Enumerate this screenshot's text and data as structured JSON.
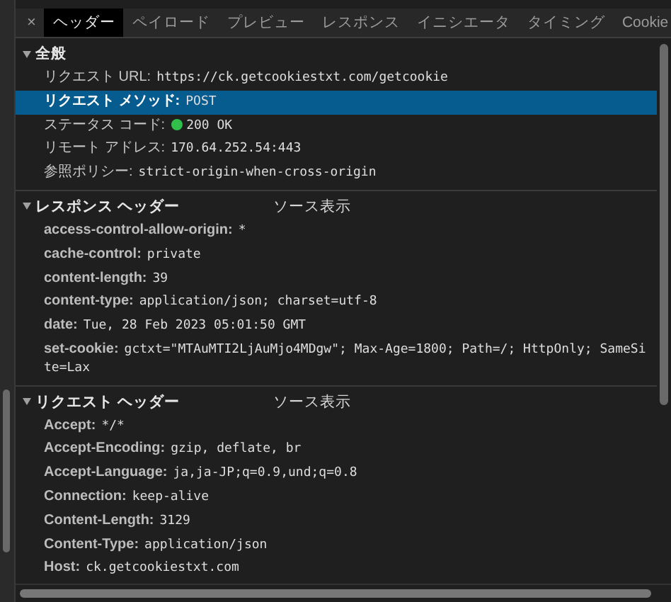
{
  "close_label": "×",
  "tabs": [
    {
      "label": "ヘッダー",
      "selected": true
    },
    {
      "label": "ペイロード",
      "selected": false
    },
    {
      "label": "プレビュー",
      "selected": false
    },
    {
      "label": "レスポンス",
      "selected": false
    },
    {
      "label": "イニシエータ",
      "selected": false
    },
    {
      "label": "タイミング",
      "selected": false
    },
    {
      "label": "Cookie",
      "selected": false
    }
  ],
  "sections": [
    {
      "title": "全般",
      "expanded": true,
      "bold_names": false,
      "rows": [
        {
          "name": "リクエスト URL:",
          "value": "https://ck.getcookiestxt.com/getcookie",
          "selected": false
        },
        {
          "name": "リクエスト メソッド:",
          "value": "POST",
          "selected": true
        },
        {
          "name": "ステータス コード:",
          "value": "200 OK",
          "selected": false,
          "color": "#2fbf4a"
        },
        {
          "name": "リモート アドレス:",
          "value": "170.64.252.54:443",
          "selected": false
        },
        {
          "name": "参照ポリシー:",
          "value": "strict-origin-when-cross-origin",
          "selected": false
        }
      ]
    },
    {
      "title": "レスポンス ヘッダー",
      "expanded": true,
      "source_label": "ソース表示",
      "bold_names": true,
      "rows": [
        {
          "name": "access-control-allow-origin:",
          "value": "*",
          "selected": false
        },
        {
          "name": "cache-control:",
          "value": "private",
          "selected": false
        },
        {
          "name": "content-length:",
          "value": "39",
          "selected": false
        },
        {
          "name": "content-type:",
          "value": "application/json; charset=utf-8",
          "selected": false
        },
        {
          "name": "date:",
          "value": "Tue, 28 Feb 2023 05:01:50 GMT",
          "selected": false
        },
        {
          "name": "set-cookie:",
          "value": "gctxt=\"MTAuMTI2LjAuMjo4MDgw\"; Max-Age=1800; Path=/; HttpOnly; SameSite=Lax",
          "selected": false
        }
      ]
    },
    {
      "title": "リクエスト ヘッダー",
      "expanded": true,
      "source_label": "ソース表示",
      "bold_names": true,
      "rows": [
        {
          "name": "Accept:",
          "value": "*/*",
          "selected": false
        },
        {
          "name": "Accept-Encoding:",
          "value": "gzip, deflate, br",
          "selected": false
        },
        {
          "name": "Accept-Language:",
          "value": "ja,ja-JP;q=0.9,und;q=0.8",
          "selected": false
        },
        {
          "name": "Connection:",
          "value": "keep-alive",
          "selected": false
        },
        {
          "name": "Content-Length:",
          "value": "3129",
          "selected": false
        },
        {
          "name": "Content-Type:",
          "value": "application/json",
          "selected": false
        },
        {
          "name": "Host:",
          "value": "ck.getcookiestxt.com",
          "selected": false
        }
      ]
    }
  ]
}
